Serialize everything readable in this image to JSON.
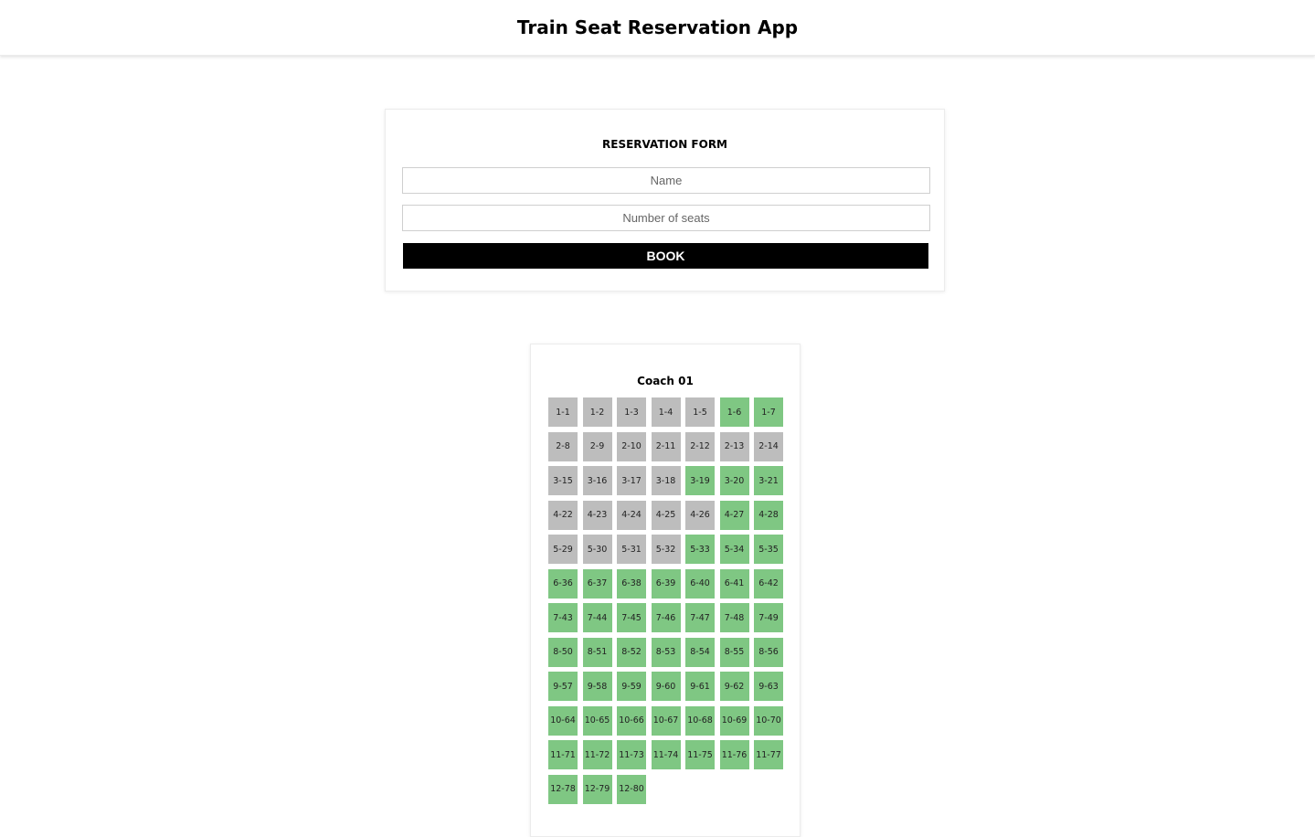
{
  "app": {
    "title": "Train Seat Reservation App"
  },
  "form": {
    "title": "RESERVATION FORM",
    "name_placeholder": "Name",
    "seats_placeholder": "Number of seats",
    "book_label": "BOOK"
  },
  "coach": {
    "title": "Coach 01",
    "colors": {
      "booked": "#bdbdbd",
      "available": "#7fc783"
    },
    "seats": [
      {
        "label": "1-1",
        "status": "booked"
      },
      {
        "label": "1-2",
        "status": "booked"
      },
      {
        "label": "1-3",
        "status": "booked"
      },
      {
        "label": "1-4",
        "status": "booked"
      },
      {
        "label": "1-5",
        "status": "booked"
      },
      {
        "label": "1-6",
        "status": "available"
      },
      {
        "label": "1-7",
        "status": "available"
      },
      {
        "label": "2-8",
        "status": "booked"
      },
      {
        "label": "2-9",
        "status": "booked"
      },
      {
        "label": "2-10",
        "status": "booked"
      },
      {
        "label": "2-11",
        "status": "booked"
      },
      {
        "label": "2-12",
        "status": "booked"
      },
      {
        "label": "2-13",
        "status": "booked"
      },
      {
        "label": "2-14",
        "status": "booked"
      },
      {
        "label": "3-15",
        "status": "booked"
      },
      {
        "label": "3-16",
        "status": "booked"
      },
      {
        "label": "3-17",
        "status": "booked"
      },
      {
        "label": "3-18",
        "status": "booked"
      },
      {
        "label": "3-19",
        "status": "available"
      },
      {
        "label": "3-20",
        "status": "available"
      },
      {
        "label": "3-21",
        "status": "available"
      },
      {
        "label": "4-22",
        "status": "booked"
      },
      {
        "label": "4-23",
        "status": "booked"
      },
      {
        "label": "4-24",
        "status": "booked"
      },
      {
        "label": "4-25",
        "status": "booked"
      },
      {
        "label": "4-26",
        "status": "booked"
      },
      {
        "label": "4-27",
        "status": "available"
      },
      {
        "label": "4-28",
        "status": "available"
      },
      {
        "label": "5-29",
        "status": "booked"
      },
      {
        "label": "5-30",
        "status": "booked"
      },
      {
        "label": "5-31",
        "status": "booked"
      },
      {
        "label": "5-32",
        "status": "booked"
      },
      {
        "label": "5-33",
        "status": "available"
      },
      {
        "label": "5-34",
        "status": "available"
      },
      {
        "label": "5-35",
        "status": "available"
      },
      {
        "label": "6-36",
        "status": "available"
      },
      {
        "label": "6-37",
        "status": "available"
      },
      {
        "label": "6-38",
        "status": "available"
      },
      {
        "label": "6-39",
        "status": "available"
      },
      {
        "label": "6-40",
        "status": "available"
      },
      {
        "label": "6-41",
        "status": "available"
      },
      {
        "label": "6-42",
        "status": "available"
      },
      {
        "label": "7-43",
        "status": "available"
      },
      {
        "label": "7-44",
        "status": "available"
      },
      {
        "label": "7-45",
        "status": "available"
      },
      {
        "label": "7-46",
        "status": "available"
      },
      {
        "label": "7-47",
        "status": "available"
      },
      {
        "label": "7-48",
        "status": "available"
      },
      {
        "label": "7-49",
        "status": "available"
      },
      {
        "label": "8-50",
        "status": "available"
      },
      {
        "label": "8-51",
        "status": "available"
      },
      {
        "label": "8-52",
        "status": "available"
      },
      {
        "label": "8-53",
        "status": "available"
      },
      {
        "label": "8-54",
        "status": "available"
      },
      {
        "label": "8-55",
        "status": "available"
      },
      {
        "label": "8-56",
        "status": "available"
      },
      {
        "label": "9-57",
        "status": "available"
      },
      {
        "label": "9-58",
        "status": "available"
      },
      {
        "label": "9-59",
        "status": "available"
      },
      {
        "label": "9-60",
        "status": "available"
      },
      {
        "label": "9-61",
        "status": "available"
      },
      {
        "label": "9-62",
        "status": "available"
      },
      {
        "label": "9-63",
        "status": "available"
      },
      {
        "label": "10-64",
        "status": "available"
      },
      {
        "label": "10-65",
        "status": "available"
      },
      {
        "label": "10-66",
        "status": "available"
      },
      {
        "label": "10-67",
        "status": "available"
      },
      {
        "label": "10-68",
        "status": "available"
      },
      {
        "label": "10-69",
        "status": "available"
      },
      {
        "label": "10-70",
        "status": "available"
      },
      {
        "label": "11-71",
        "status": "available"
      },
      {
        "label": "11-72",
        "status": "available"
      },
      {
        "label": "11-73",
        "status": "available"
      },
      {
        "label": "11-74",
        "status": "available"
      },
      {
        "label": "11-75",
        "status": "available"
      },
      {
        "label": "11-76",
        "status": "available"
      },
      {
        "label": "11-77",
        "status": "available"
      },
      {
        "label": "12-78",
        "status": "available"
      },
      {
        "label": "12-79",
        "status": "available"
      },
      {
        "label": "12-80",
        "status": "available"
      }
    ]
  }
}
